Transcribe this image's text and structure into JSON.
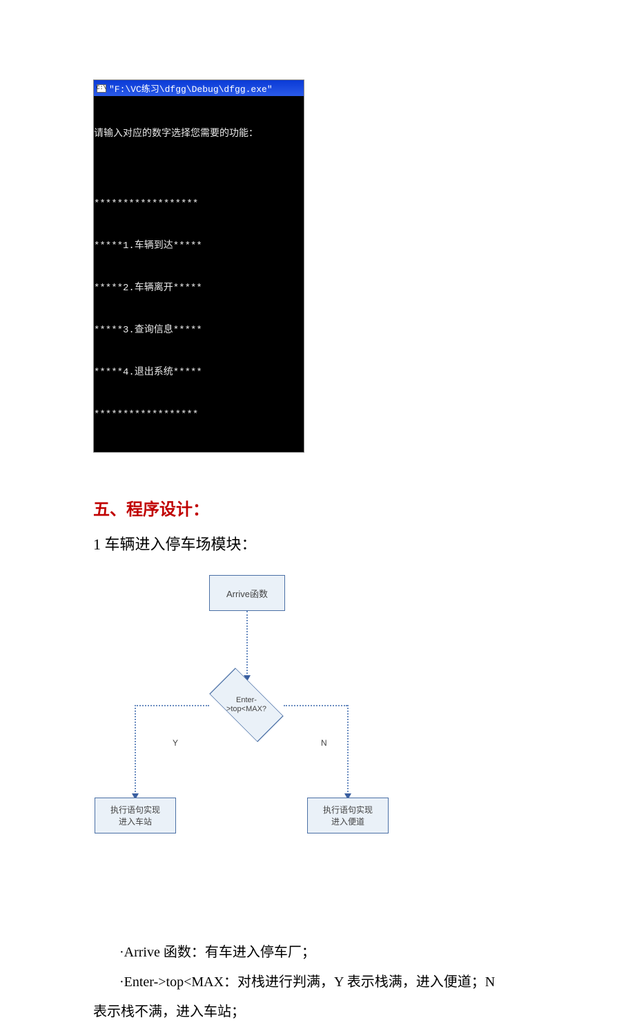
{
  "chart_data": {
    "type": "diagram",
    "nodes": [
      {
        "id": "arrive",
        "label": "Arrive函数",
        "shape": "rect"
      },
      {
        "id": "cond",
        "label": "Enter->top<MAX?",
        "shape": "decision"
      },
      {
        "id": "y_out",
        "label": "执行语句实现\n进入车站",
        "shape": "rect"
      },
      {
        "id": "n_out",
        "label": "执行语句实现\n进入便道",
        "shape": "rect"
      }
    ],
    "edges": [
      {
        "from": "arrive",
        "to": "cond",
        "label": ""
      },
      {
        "from": "cond",
        "to": "y_out",
        "label": "Y"
      },
      {
        "from": "cond",
        "to": "n_out",
        "label": "N"
      }
    ]
  },
  "terminal": {
    "title": "\"F:\\VC练习\\dfgg\\Debug\\dfgg.exe\"",
    "icon": "C:\\",
    "lines": [
      "请输入对应的数字选择您需要的功能：",
      "",
      "******************",
      "*****1.车辆到达*****",
      "*****2.车辆离开*****",
      "*****3.查询信息*****",
      "*****4.退出系统*****",
      "******************"
    ]
  },
  "section": {
    "title": "五、程序设计："
  },
  "sub": {
    "title": "1 车辆进入停车场模块："
  },
  "flow": {
    "arrive": "Arrive函数",
    "cond_l1": "Enter-",
    "cond_l2": ">top<MAX?",
    "y": "Y",
    "n": "N",
    "box_y_l1": "执行语句实现",
    "box_y_l2": "进入车站",
    "box_n_l1": "执行语句实现",
    "box_n_l2": "进入便道"
  },
  "bullets": {
    "b1": "·Arrive 函数：有车进入停车厂；",
    "b2": "·Enter->top<MAX：对栈进行判满，Y 表示栈满，进入便道；N",
    "b2w": "表示栈不满，进入车站；"
  }
}
